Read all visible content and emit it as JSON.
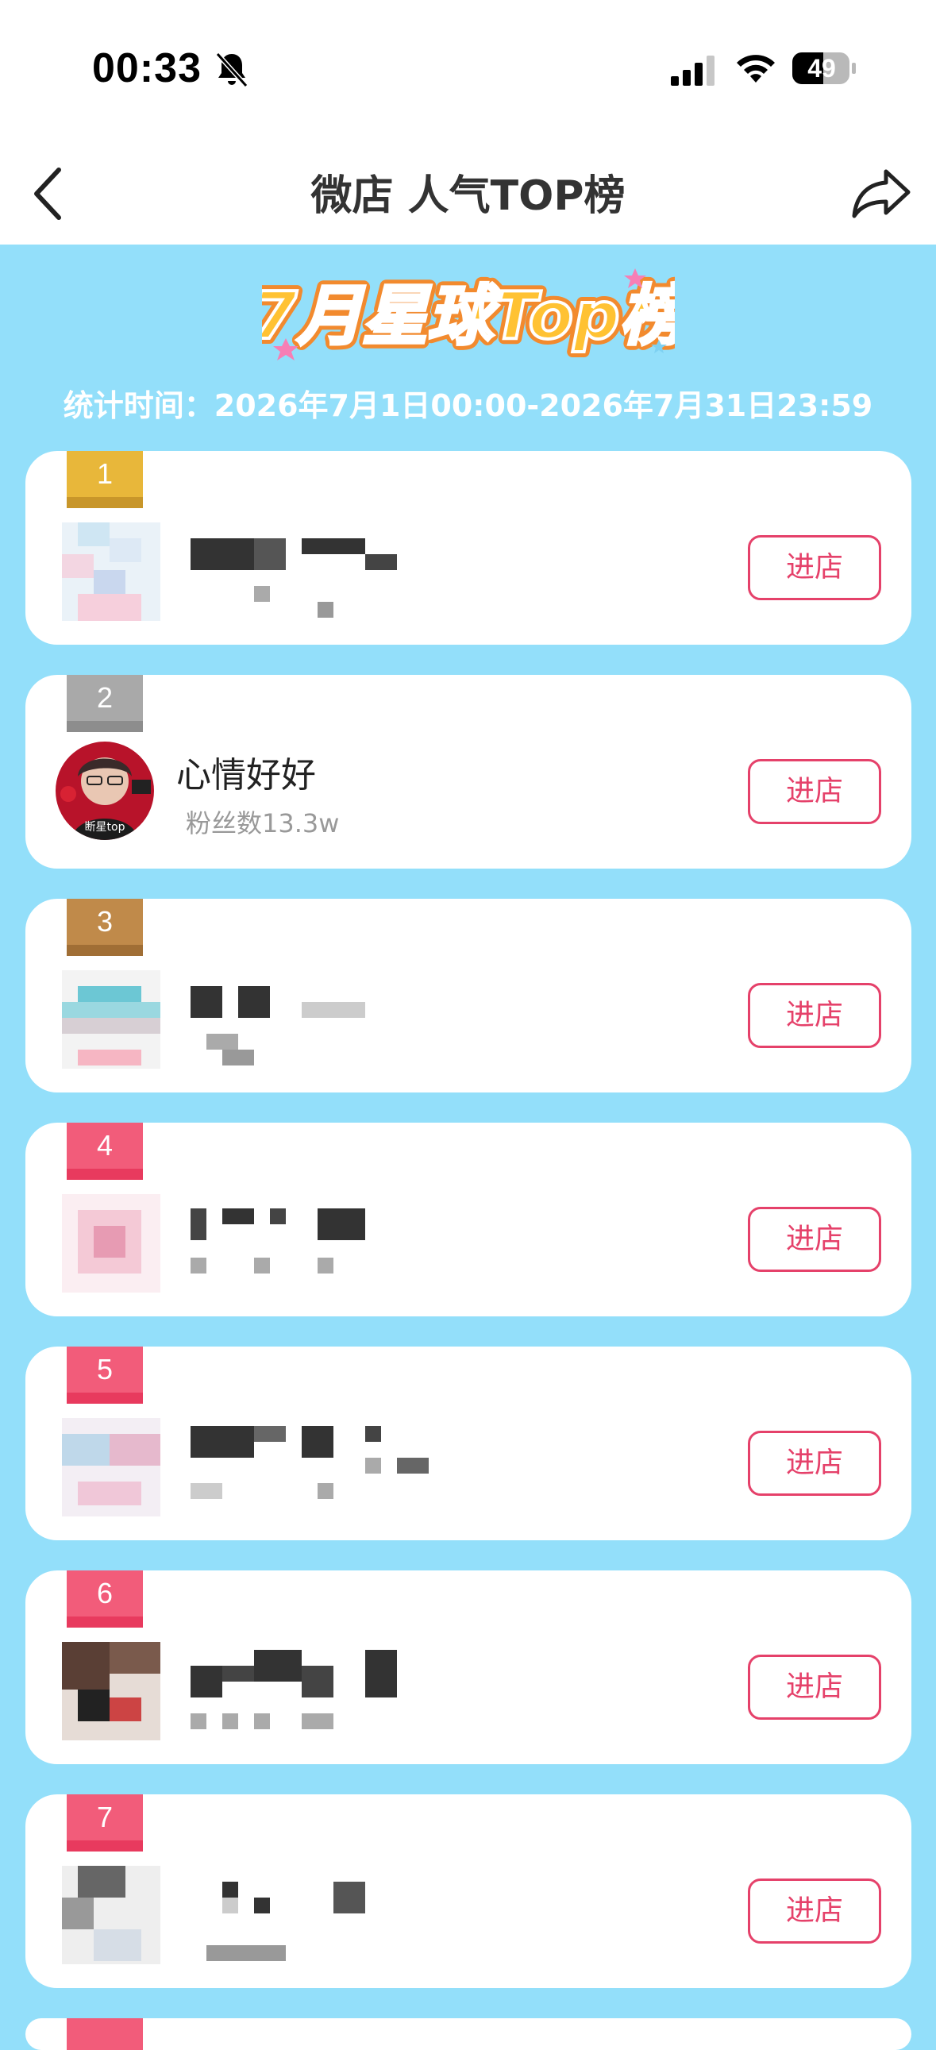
{
  "status_bar": {
    "time": "00:33",
    "battery": "49"
  },
  "nav": {
    "title": "微店 人气TOP榜"
  },
  "banner": {
    "title": "7月星球Top榜"
  },
  "stats": {
    "label": "统计时间：2026年7月1日00:00-2026年7月31日23:59"
  },
  "ranks": [
    {
      "rank": "1",
      "name": "",
      "fans": "",
      "button": "进店"
    },
    {
      "rank": "2",
      "name": "心情好好",
      "fans": "粉丝数13.3w",
      "button": "进店"
    },
    {
      "rank": "3",
      "name": "",
      "fans": "",
      "button": "进店"
    },
    {
      "rank": "4",
      "name": "",
      "fans": "",
      "button": "进店"
    },
    {
      "rank": "5",
      "name": "",
      "fans": "",
      "button": "进店"
    },
    {
      "rank": "6",
      "name": "",
      "fans": "",
      "button": "进店"
    },
    {
      "rank": "7",
      "name": "",
      "fans": "",
      "button": "进店"
    }
  ],
  "colors": {
    "background": "#93DFFA",
    "accent": "#E5416A",
    "gold": "#E8B73A",
    "silver": "#A9A9A9",
    "bronze": "#C08A4A",
    "pink_badge": "#F25C7A"
  }
}
